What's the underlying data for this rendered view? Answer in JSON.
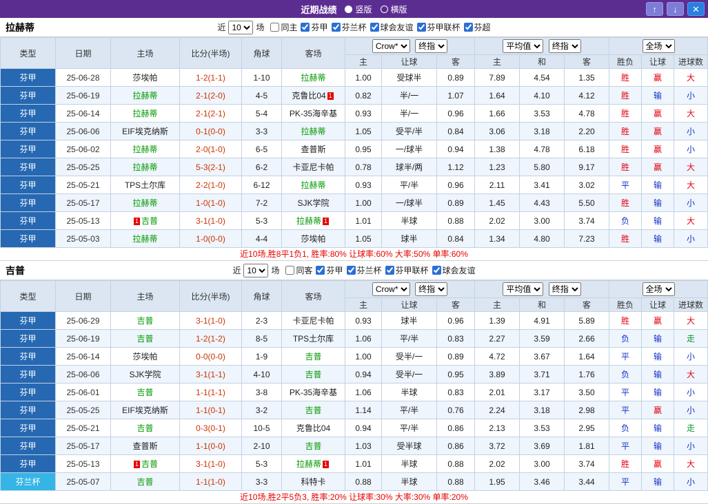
{
  "titlebar": {
    "title": "近期战绩",
    "vertical_label": "竖版",
    "horizontal_label": "横版",
    "up_icon": "↑",
    "down_icon": "↓",
    "close_icon": "✕"
  },
  "colors": {
    "titlebar_purple": "#5c2d91",
    "league_blue": "#2668b2",
    "cup_cyan": "#35b5e5",
    "team_green": "#009900",
    "score_red": "#cc3300",
    "win_red": "#e60012",
    "loss_blue": "#1430cc",
    "zou_green": "#0a9a32",
    "table_header_bg": "#dce6f2"
  },
  "common": {
    "recent_label": "近",
    "matches_label": "场",
    "rounds_value": "10",
    "bookmaker_option": "Crow*",
    "stage_option": "终指",
    "average_option": "平均值",
    "scope_option": "全场",
    "headers": [
      "类型",
      "日期",
      "主场",
      "比分(半场)",
      "角球",
      "客场"
    ],
    "subheaders": [
      "主",
      "让球",
      "客",
      "主",
      "和",
      "客",
      "胜负",
      "让球",
      "进球数"
    ],
    "red_card_text": "1"
  },
  "sections": [
    {
      "team": "拉赫蒂",
      "filters": [
        {
          "label": "同主",
          "checked": false
        },
        {
          "label": "芬甲",
          "checked": true
        },
        {
          "label": "芬兰杯",
          "checked": true
        },
        {
          "label": "球会友谊",
          "checked": true
        },
        {
          "label": "芬甲联杯",
          "checked": true
        },
        {
          "label": "芬超",
          "checked": true
        }
      ],
      "rows": [
        {
          "lg": "芬甲",
          "cup": false,
          "date": "25-06-28",
          "home": {
            "n": "莎埃帕",
            "g": false,
            "cb": false,
            "ca": false
          },
          "score": "1-2(1-1)",
          "corner": "1-10",
          "away": {
            "n": "拉赫蒂",
            "g": true,
            "cb": false,
            "ca": false
          },
          "o": [
            "1.00",
            "受球半",
            "0.89"
          ],
          "a": [
            "7.89",
            "4.54",
            "1.35"
          ],
          "r": [
            [
              "胜",
              "r"
            ],
            [
              "赢",
              "r"
            ],
            [
              "大",
              "r"
            ]
          ]
        },
        {
          "lg": "芬甲",
          "cup": false,
          "date": "25-06-19",
          "home": {
            "n": "拉赫蒂",
            "g": true,
            "cb": false,
            "ca": false
          },
          "score": "2-1(2-0)",
          "corner": "4-5",
          "away": {
            "n": "克鲁比04",
            "g": false,
            "cb": false,
            "ca": true
          },
          "o": [
            "0.82",
            "半/一",
            "1.07"
          ],
          "a": [
            "1.64",
            "4.10",
            "4.12"
          ],
          "r": [
            [
              "胜",
              "r"
            ],
            [
              "输",
              "b"
            ],
            [
              "小",
              "b"
            ]
          ]
        },
        {
          "lg": "芬甲",
          "cup": false,
          "date": "25-06-14",
          "home": {
            "n": "拉赫蒂",
            "g": true,
            "cb": false,
            "ca": false
          },
          "score": "2-1(2-1)",
          "corner": "5-4",
          "away": {
            "n": "PK-35海辛基",
            "g": false,
            "cb": false,
            "ca": false
          },
          "o": [
            "0.93",
            "半/一",
            "0.96"
          ],
          "a": [
            "1.66",
            "3.53",
            "4.78"
          ],
          "r": [
            [
              "胜",
              "r"
            ],
            [
              "赢",
              "r"
            ],
            [
              "大",
              "r"
            ]
          ]
        },
        {
          "lg": "芬甲",
          "cup": false,
          "date": "25-06-06",
          "home": {
            "n": "EIF埃克纳斯",
            "g": false,
            "cb": false,
            "ca": false
          },
          "score": "0-1(0-0)",
          "corner": "3-3",
          "away": {
            "n": "拉赫蒂",
            "g": true,
            "cb": false,
            "ca": false
          },
          "o": [
            "1.05",
            "受平/半",
            "0.84"
          ],
          "a": [
            "3.06",
            "3.18",
            "2.20"
          ],
          "r": [
            [
              "胜",
              "r"
            ],
            [
              "赢",
              "r"
            ],
            [
              "小",
              "b"
            ]
          ]
        },
        {
          "lg": "芬甲",
          "cup": false,
          "date": "25-06-02",
          "home": {
            "n": "拉赫蒂",
            "g": true,
            "cb": false,
            "ca": false
          },
          "score": "2-0(1-0)",
          "corner": "6-5",
          "away": {
            "n": "查普斯",
            "g": false,
            "cb": false,
            "ca": false
          },
          "o": [
            "0.95",
            "一/球半",
            "0.94"
          ],
          "a": [
            "1.38",
            "4.78",
            "6.18"
          ],
          "r": [
            [
              "胜",
              "r"
            ],
            [
              "赢",
              "r"
            ],
            [
              "小",
              "b"
            ]
          ]
        },
        {
          "lg": "芬甲",
          "cup": false,
          "date": "25-05-25",
          "home": {
            "n": "拉赫蒂",
            "g": true,
            "cb": false,
            "ca": false
          },
          "score": "5-3(2-1)",
          "corner": "6-2",
          "away": {
            "n": "卡亚尼卡帕",
            "g": false,
            "cb": false,
            "ca": false
          },
          "o": [
            "0.78",
            "球半/两",
            "1.12"
          ],
          "a": [
            "1.23",
            "5.80",
            "9.17"
          ],
          "r": [
            [
              "胜",
              "r"
            ],
            [
              "赢",
              "r"
            ],
            [
              "大",
              "r"
            ]
          ]
        },
        {
          "lg": "芬甲",
          "cup": false,
          "date": "25-05-21",
          "home": {
            "n": "TPS土尔库",
            "g": false,
            "cb": false,
            "ca": false
          },
          "score": "2-2(1-0)",
          "corner": "6-12",
          "away": {
            "n": "拉赫蒂",
            "g": true,
            "cb": false,
            "ca": false
          },
          "o": [
            "0.93",
            "平/半",
            "0.96"
          ],
          "a": [
            "2.11",
            "3.41",
            "3.02"
          ],
          "r": [
            [
              "平",
              "b"
            ],
            [
              "输",
              "b"
            ],
            [
              "大",
              "r"
            ]
          ]
        },
        {
          "lg": "芬甲",
          "cup": false,
          "date": "25-05-17",
          "home": {
            "n": "拉赫蒂",
            "g": true,
            "cb": false,
            "ca": false
          },
          "score": "1-0(1-0)",
          "corner": "7-2",
          "away": {
            "n": "SJK学院",
            "g": false,
            "cb": false,
            "ca": false
          },
          "o": [
            "1.00",
            "一/球半",
            "0.89"
          ],
          "a": [
            "1.45",
            "4.43",
            "5.50"
          ],
          "r": [
            [
              "胜",
              "r"
            ],
            [
              "输",
              "b"
            ],
            [
              "小",
              "b"
            ]
          ]
        },
        {
          "lg": "芬甲",
          "cup": false,
          "date": "25-05-13",
          "home": {
            "n": "吉普",
            "g": true,
            "cb": true,
            "ca": false
          },
          "score": "3-1(1-0)",
          "corner": "5-3",
          "away": {
            "n": "拉赫蒂",
            "g": true,
            "cb": false,
            "ca": true
          },
          "o": [
            "1.01",
            "半球",
            "0.88"
          ],
          "a": [
            "2.02",
            "3.00",
            "3.74"
          ],
          "r": [
            [
              "负",
              "b"
            ],
            [
              "输",
              "b"
            ],
            [
              "大",
              "r"
            ]
          ]
        },
        {
          "lg": "芬甲",
          "cup": false,
          "date": "25-05-03",
          "home": {
            "n": "拉赫蒂",
            "g": true,
            "cb": false,
            "ca": false
          },
          "score": "1-0(0-0)",
          "corner": "4-4",
          "away": {
            "n": "莎埃帕",
            "g": false,
            "cb": false,
            "ca": false
          },
          "o": [
            "1.05",
            "球半",
            "0.84"
          ],
          "a": [
            "1.34",
            "4.80",
            "7.23"
          ],
          "r": [
            [
              "胜",
              "r"
            ],
            [
              "输",
              "b"
            ],
            [
              "小",
              "b"
            ]
          ]
        }
      ],
      "summary": "近10场,胜8平1负1, 胜率:80% 让球率:60% 大率:50% 单率:60%"
    },
    {
      "team": "吉普",
      "filters": [
        {
          "label": "同客",
          "checked": false
        },
        {
          "label": "芬甲",
          "checked": true
        },
        {
          "label": "芬兰杯",
          "checked": true
        },
        {
          "label": "芬甲联杯",
          "checked": true
        },
        {
          "label": "球会友谊",
          "checked": true
        }
      ],
      "rows": [
        {
          "lg": "芬甲",
          "cup": false,
          "date": "25-06-29",
          "home": {
            "n": "吉普",
            "g": true,
            "cb": false,
            "ca": false
          },
          "score": "3-1(1-0)",
          "corner": "2-3",
          "away": {
            "n": "卡亚尼卡帕",
            "g": false,
            "cb": false,
            "ca": false
          },
          "o": [
            "0.93",
            "球半",
            "0.96"
          ],
          "a": [
            "1.39",
            "4.91",
            "5.89"
          ],
          "r": [
            [
              "胜",
              "r"
            ],
            [
              "赢",
              "r"
            ],
            [
              "大",
              "r"
            ]
          ]
        },
        {
          "lg": "芬甲",
          "cup": false,
          "date": "25-06-19",
          "home": {
            "n": "吉普",
            "g": true,
            "cb": false,
            "ca": false
          },
          "score": "1-2(1-2)",
          "corner": "8-5",
          "away": {
            "n": "TPS土尔库",
            "g": false,
            "cb": false,
            "ca": false
          },
          "o": [
            "1.06",
            "平/半",
            "0.83"
          ],
          "a": [
            "2.27",
            "3.59",
            "2.66"
          ],
          "r": [
            [
              "负",
              "b"
            ],
            [
              "输",
              "b"
            ],
            [
              "走",
              "g"
            ]
          ]
        },
        {
          "lg": "芬甲",
          "cup": false,
          "date": "25-06-14",
          "home": {
            "n": "莎埃帕",
            "g": false,
            "cb": false,
            "ca": false
          },
          "score": "0-0(0-0)",
          "corner": "1-9",
          "away": {
            "n": "吉普",
            "g": true,
            "cb": false,
            "ca": false
          },
          "o": [
            "1.00",
            "受半/一",
            "0.89"
          ],
          "a": [
            "4.72",
            "3.67",
            "1.64"
          ],
          "r": [
            [
              "平",
              "b"
            ],
            [
              "输",
              "b"
            ],
            [
              "小",
              "b"
            ]
          ]
        },
        {
          "lg": "芬甲",
          "cup": false,
          "date": "25-06-06",
          "home": {
            "n": "SJK学院",
            "g": false,
            "cb": false,
            "ca": false
          },
          "score": "3-1(1-1)",
          "corner": "4-10",
          "away": {
            "n": "吉普",
            "g": true,
            "cb": false,
            "ca": false
          },
          "o": [
            "0.94",
            "受半/一",
            "0.95"
          ],
          "a": [
            "3.89",
            "3.71",
            "1.76"
          ],
          "r": [
            [
              "负",
              "b"
            ],
            [
              "输",
              "b"
            ],
            [
              "大",
              "r"
            ]
          ]
        },
        {
          "lg": "芬甲",
          "cup": false,
          "date": "25-06-01",
          "home": {
            "n": "吉普",
            "g": true,
            "cb": false,
            "ca": false
          },
          "score": "1-1(1-1)",
          "corner": "3-8",
          "away": {
            "n": "PK-35海辛基",
            "g": false,
            "cb": false,
            "ca": false
          },
          "o": [
            "1.06",
            "半球",
            "0.83"
          ],
          "a": [
            "2.01",
            "3.17",
            "3.50"
          ],
          "r": [
            [
              "平",
              "b"
            ],
            [
              "输",
              "b"
            ],
            [
              "小",
              "b"
            ]
          ]
        },
        {
          "lg": "芬甲",
          "cup": false,
          "date": "25-05-25",
          "home": {
            "n": "EIF埃克纳斯",
            "g": false,
            "cb": false,
            "ca": false
          },
          "score": "1-1(0-1)",
          "corner": "3-2",
          "away": {
            "n": "吉普",
            "g": true,
            "cb": false,
            "ca": false
          },
          "o": [
            "1.14",
            "平/半",
            "0.76"
          ],
          "a": [
            "2.24",
            "3.18",
            "2.98"
          ],
          "r": [
            [
              "平",
              "b"
            ],
            [
              "赢",
              "r"
            ],
            [
              "小",
              "b"
            ]
          ]
        },
        {
          "lg": "芬甲",
          "cup": false,
          "date": "25-05-21",
          "home": {
            "n": "吉普",
            "g": true,
            "cb": false,
            "ca": false
          },
          "score": "0-3(0-1)",
          "corner": "10-5",
          "away": {
            "n": "克鲁比04",
            "g": false,
            "cb": false,
            "ca": false
          },
          "o": [
            "0.94",
            "平/半",
            "0.86"
          ],
          "a": [
            "2.13",
            "3.53",
            "2.95"
          ],
          "r": [
            [
              "负",
              "b"
            ],
            [
              "输",
              "b"
            ],
            [
              "走",
              "g"
            ]
          ]
        },
        {
          "lg": "芬甲",
          "cup": false,
          "date": "25-05-17",
          "home": {
            "n": "查普斯",
            "g": false,
            "cb": false,
            "ca": false
          },
          "score": "1-1(0-0)",
          "corner": "2-10",
          "away": {
            "n": "吉普",
            "g": true,
            "cb": false,
            "ca": false
          },
          "o": [
            "1.03",
            "受半球",
            "0.86"
          ],
          "a": [
            "3.72",
            "3.69",
            "1.81"
          ],
          "r": [
            [
              "平",
              "b"
            ],
            [
              "输",
              "b"
            ],
            [
              "小",
              "b"
            ]
          ]
        },
        {
          "lg": "芬甲",
          "cup": false,
          "date": "25-05-13",
          "home": {
            "n": "吉普",
            "g": true,
            "cb": true,
            "ca": false
          },
          "score": "3-1(1-0)",
          "corner": "5-3",
          "away": {
            "n": "拉赫蒂",
            "g": true,
            "cb": false,
            "ca": true
          },
          "o": [
            "1.01",
            "半球",
            "0.88"
          ],
          "a": [
            "2.02",
            "3.00",
            "3.74"
          ],
          "r": [
            [
              "胜",
              "r"
            ],
            [
              "赢",
              "r"
            ],
            [
              "大",
              "r"
            ]
          ]
        },
        {
          "lg": "芬兰杯",
          "cup": true,
          "date": "25-05-07",
          "home": {
            "n": "吉普",
            "g": true,
            "cb": false,
            "ca": false
          },
          "score": "1-1(1-0)",
          "corner": "3-3",
          "away": {
            "n": "科特卡",
            "g": false,
            "cb": false,
            "ca": false
          },
          "o": [
            "0.88",
            "半球",
            "0.88"
          ],
          "a": [
            "1.95",
            "3.46",
            "3.44"
          ],
          "r": [
            [
              "平",
              "b"
            ],
            [
              "输",
              "b"
            ],
            [
              "小",
              "b"
            ]
          ]
        }
      ],
      "summary": "近10场,胜2平5负3, 胜率:20% 让球率:30% 大率:30% 单率:20%"
    }
  ]
}
